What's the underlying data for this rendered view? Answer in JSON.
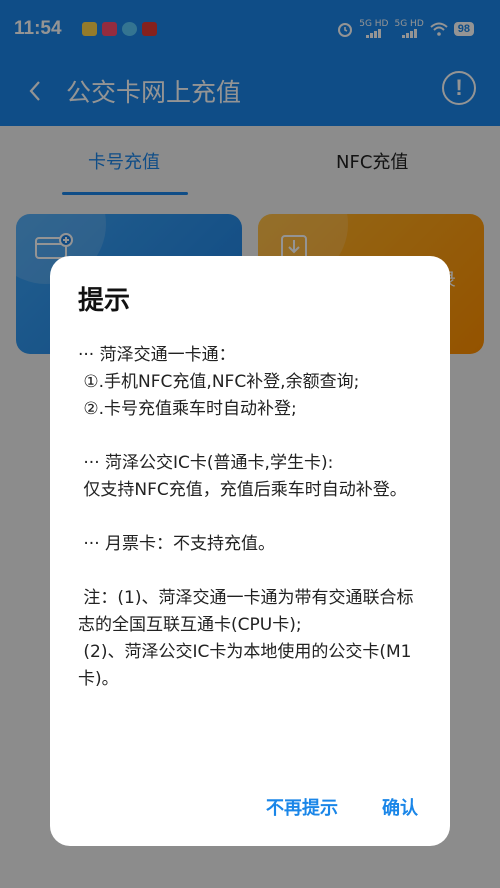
{
  "status_bar": {
    "time": "11:54",
    "sim1_label": "5G HD",
    "sim2_label": "5G HD",
    "battery": "98",
    "app_colors": [
      "#ffd54a",
      "#ff4d6d",
      "#5ac8fa",
      "#e53935"
    ]
  },
  "app_bar": {
    "title": "公交卡网上充值",
    "back_icon": "chevron-left-icon",
    "info_symbol": "!"
  },
  "tabs": [
    {
      "label": "卡号充值",
      "active": true
    },
    {
      "label": "NFC充值",
      "active": false
    }
  ],
  "cards": [
    {
      "title": "",
      "subtitle": "",
      "icon": "card-recharge-icon",
      "color": "#2f93ef"
    },
    {
      "title": "录",
      "subtitle": "询",
      "icon": "download-icon",
      "color": "#ffa31a"
    }
  ],
  "dialog": {
    "title": "提示",
    "body": "··· 菏泽交通一卡通：\n ①.手机NFC充值,NFC补登,余额查询;\n ②.卡号充值乘车时自动补登;\n\n ··· 菏泽公交IC卡(普通卡,学生卡):\n 仅支持NFC充值，充值后乘车时自动补登。\n\n ··· 月票卡：不支持充值。\n\n 注：(1)、菏泽交通一卡通为带有交通联合标志的全国互联互通卡(CPU卡);\n (2)、菏泽公交IC卡为本地使用的公交卡(M1卡)。",
    "btn_dismiss": "不再提示",
    "btn_confirm": "确认"
  }
}
